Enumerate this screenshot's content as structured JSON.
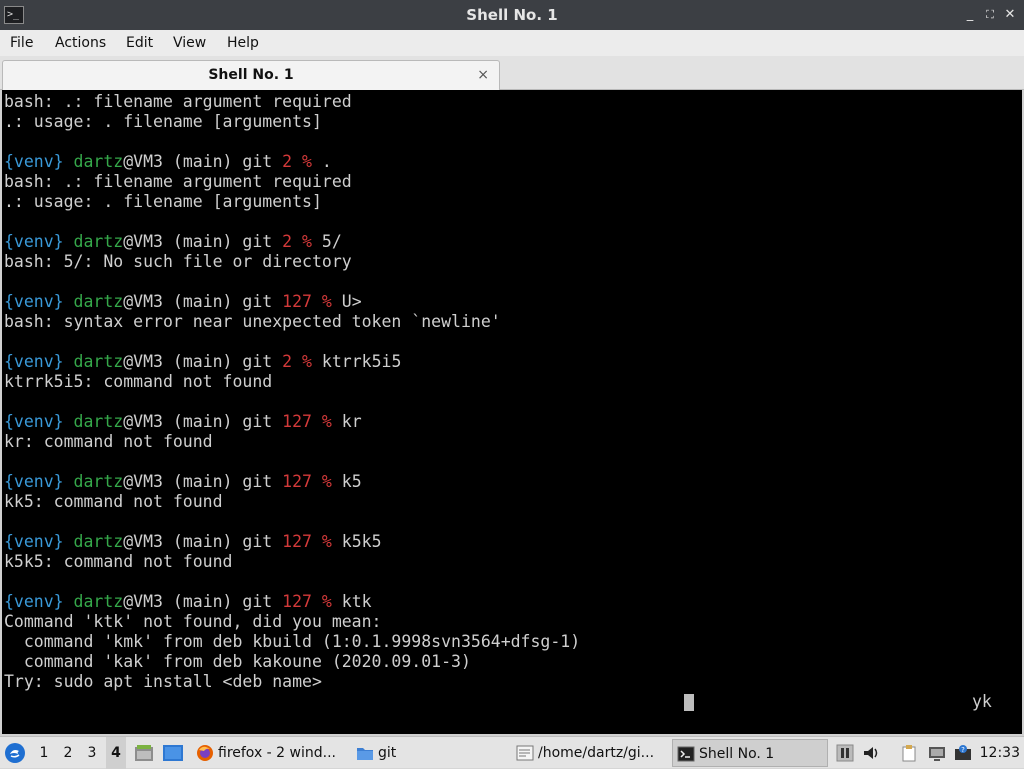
{
  "window": {
    "title": "Shell No. 1",
    "controls": {
      "minimize": "_",
      "maximize": "⛶",
      "close": "✕"
    }
  },
  "menu": {
    "items": [
      "File",
      "Actions",
      "Edit",
      "View",
      "Help"
    ]
  },
  "tabs": [
    {
      "label": "Shell No. 1",
      "close": "×"
    }
  ],
  "terminal": {
    "lines": [
      {
        "text": "bash: .: filename argument required"
      },
      {
        "text": ".: usage: . filename [arguments]"
      },
      {
        "text": ""
      },
      {
        "prompt": {
          "venv": "{venv}",
          "user": "dartz",
          "host": "@VM3 (main) git ",
          "code": "2",
          "sep": " % "
        },
        "text": "."
      },
      {
        "text": "bash: .: filename argument required"
      },
      {
        "text": ".: usage: . filename [arguments]"
      },
      {
        "text": ""
      },
      {
        "prompt": {
          "venv": "{venv}",
          "user": "dartz",
          "host": "@VM3 (main) git ",
          "code": "2",
          "sep": " % "
        },
        "text": "5/"
      },
      {
        "text": "bash: 5/: No such file or directory"
      },
      {
        "text": ""
      },
      {
        "prompt": {
          "venv": "{venv}",
          "user": "dartz",
          "host": "@VM3 (main) git ",
          "code": "127",
          "sep": " % "
        },
        "text": "U>"
      },
      {
        "text": "bash: syntax error near unexpected token `newline'"
      },
      {
        "text": ""
      },
      {
        "prompt": {
          "venv": "{venv}",
          "user": "dartz",
          "host": "@VM3 (main) git ",
          "code": "2",
          "sep": " % "
        },
        "text": "ktrrk5i5"
      },
      {
        "text": "ktrrk5i5: command not found"
      },
      {
        "text": ""
      },
      {
        "prompt": {
          "venv": "{venv}",
          "user": "dartz",
          "host": "@VM3 (main) git ",
          "code": "127",
          "sep": " % "
        },
        "text": "kr"
      },
      {
        "text": "kr: command not found"
      },
      {
        "text": ""
      },
      {
        "prompt": {
          "venv": "{venv}",
          "user": "dartz",
          "host": "@VM3 (main) git ",
          "code": "127",
          "sep": " % "
        },
        "text": "k5"
      },
      {
        "text": "kk5: command not found"
      },
      {
        "text": ""
      },
      {
        "prompt": {
          "venv": "{venv}",
          "user": "dartz",
          "host": "@VM3 (main) git ",
          "code": "127",
          "sep": " % "
        },
        "text": "k5k5"
      },
      {
        "text": "k5k5: command not found"
      },
      {
        "text": ""
      },
      {
        "prompt": {
          "venv": "{venv}",
          "user": "dartz",
          "host": "@VM3 (main) git ",
          "code": "127",
          "sep": " % "
        },
        "text": "ktk"
      },
      {
        "text": "Command 'ktk' not found, did you mean:"
      },
      {
        "text": "  command 'kmk' from deb kbuild (1:0.1.9998svn3564+dfsg-1)"
      },
      {
        "text": "  command 'kak' from deb kakoune (2020.09.01-3)"
      },
      {
        "text": "Try: sudo apt install <deb name>"
      }
    ],
    "trailing_input": "yk",
    "colors": {
      "venv": "#3a9ad9",
      "user": "#35a84a",
      "code": "#d43a3a",
      "text": "#cfcfcf",
      "background": "#000000"
    }
  },
  "taskbar": {
    "desktops": [
      "1",
      "2",
      "3",
      "4"
    ],
    "active_desktop": "4",
    "tasks": [
      {
        "label": "firefox - 2 wind...",
        "icon": "firefox-icon"
      },
      {
        "label": "git",
        "icon": "folder-icon"
      },
      {
        "label": "/home/dartz/gi...",
        "icon": "text-editor-icon"
      },
      {
        "label": "Shell No. 1",
        "icon": "terminal-icon"
      }
    ],
    "clock": "12:33"
  }
}
